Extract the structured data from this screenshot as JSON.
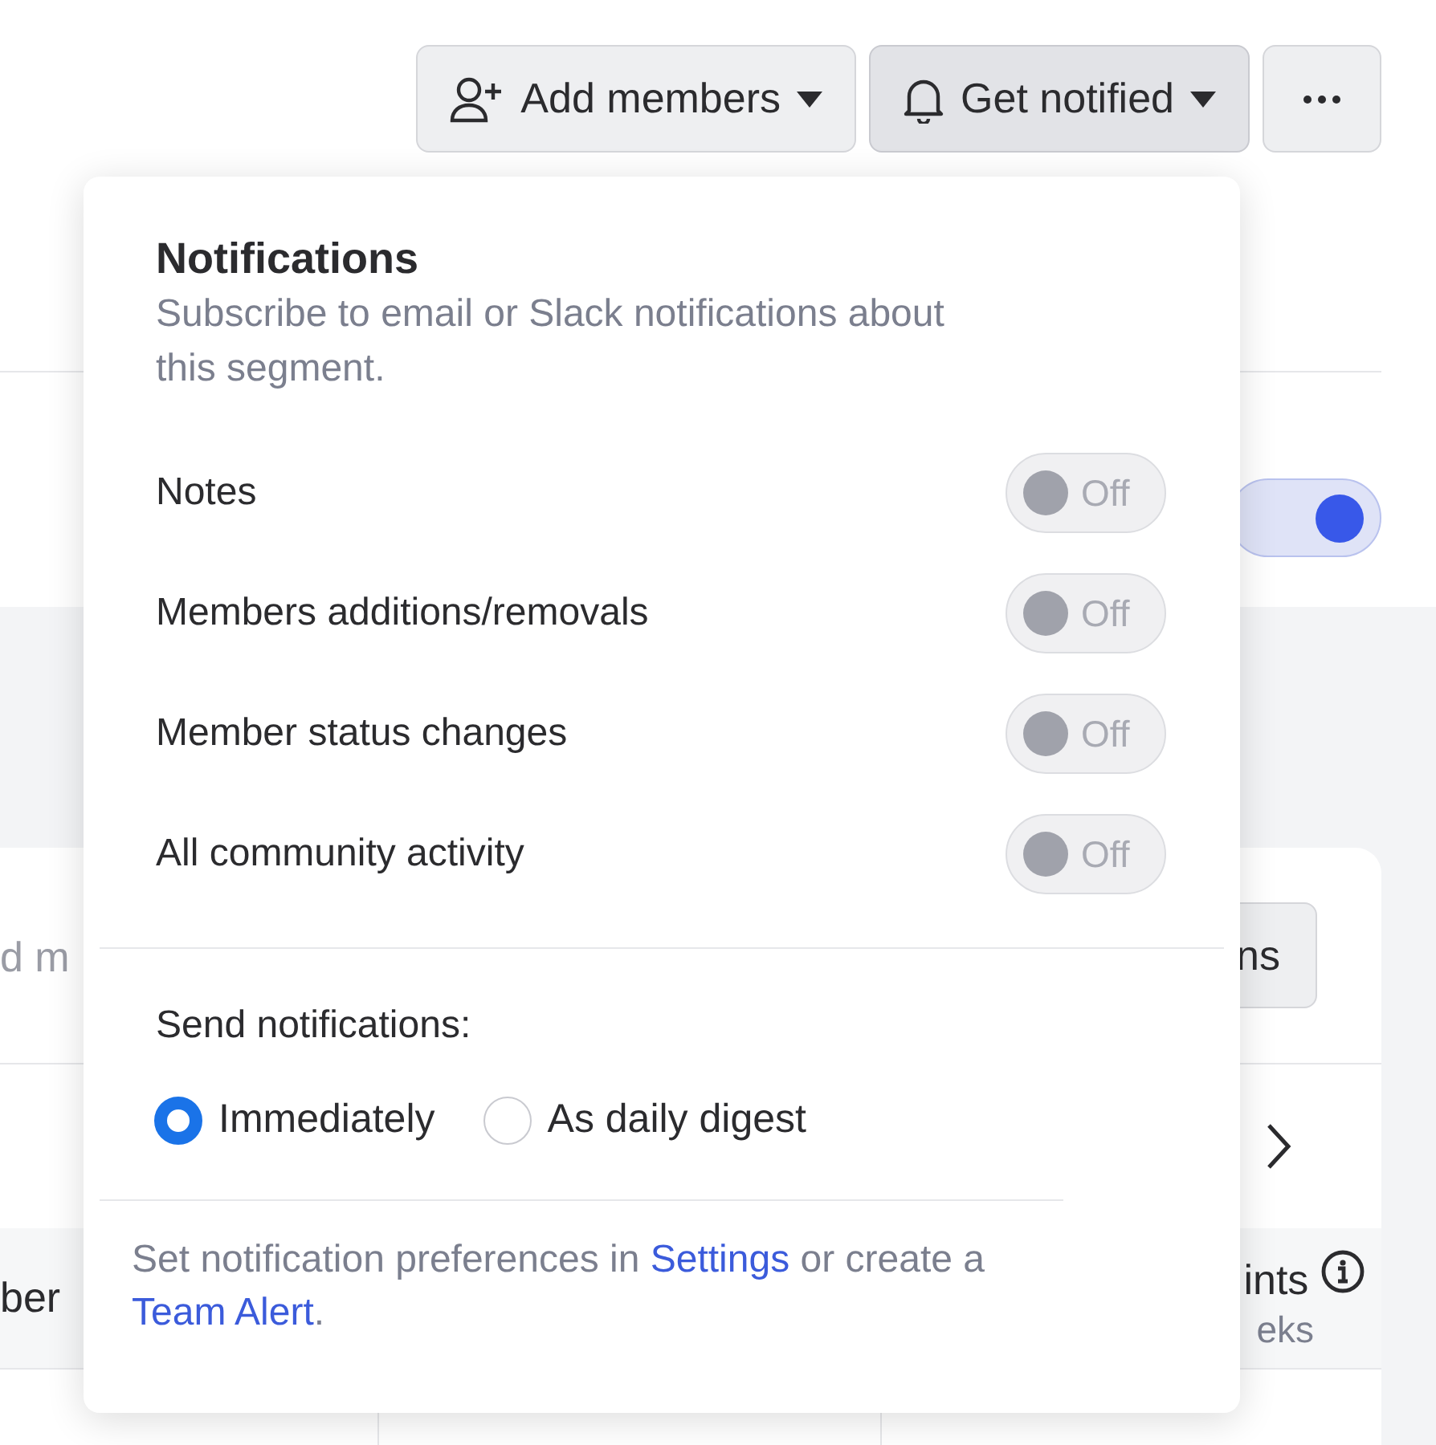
{
  "header_buttons": [
    {
      "kind": "add_member",
      "label": "Add members",
      "caret": true,
      "expanded": false
    },
    {
      "kind": "bell",
      "label": "Get notified",
      "caret": true,
      "expanded": true
    },
    {
      "kind": "more",
      "expanded": false
    }
  ],
  "background": {
    "toggle": {
      "on": true
    },
    "search": {
      "placeholder": "d m"
    },
    "button": {
      "label": "ns"
    },
    "table_header": [
      {
        "label": "ber"
      },
      {
        "label": "ints",
        "subtitle": "eks",
        "info": true
      }
    ]
  },
  "popover": {
    "title": "Notifications",
    "subtitle": "Subscribe to email or Slack notifications about this segment.",
    "toggles": [
      {
        "label": "Notes",
        "state_label": "Off",
        "on": false
      },
      {
        "label": "Members additions/removals",
        "state_label": "Off",
        "on": false
      },
      {
        "label": "Member status changes",
        "state_label": "Off",
        "on": false
      },
      {
        "label": "All community activity",
        "state_label": "Off",
        "on": false
      }
    ],
    "send_label": "Send notifications:",
    "options": [
      {
        "label": "Immediately",
        "selected": true
      },
      {
        "label": "As daily digest",
        "selected": false
      }
    ],
    "footer": [
      {
        "kind": "text",
        "text": "Set notification preferences in "
      },
      {
        "kind": "link",
        "text": "Settings"
      },
      {
        "kind": "text",
        "text": " or create a "
      },
      {
        "kind": "link",
        "text": "Team Alert"
      },
      {
        "kind": "text",
        "text": "."
      }
    ]
  }
}
